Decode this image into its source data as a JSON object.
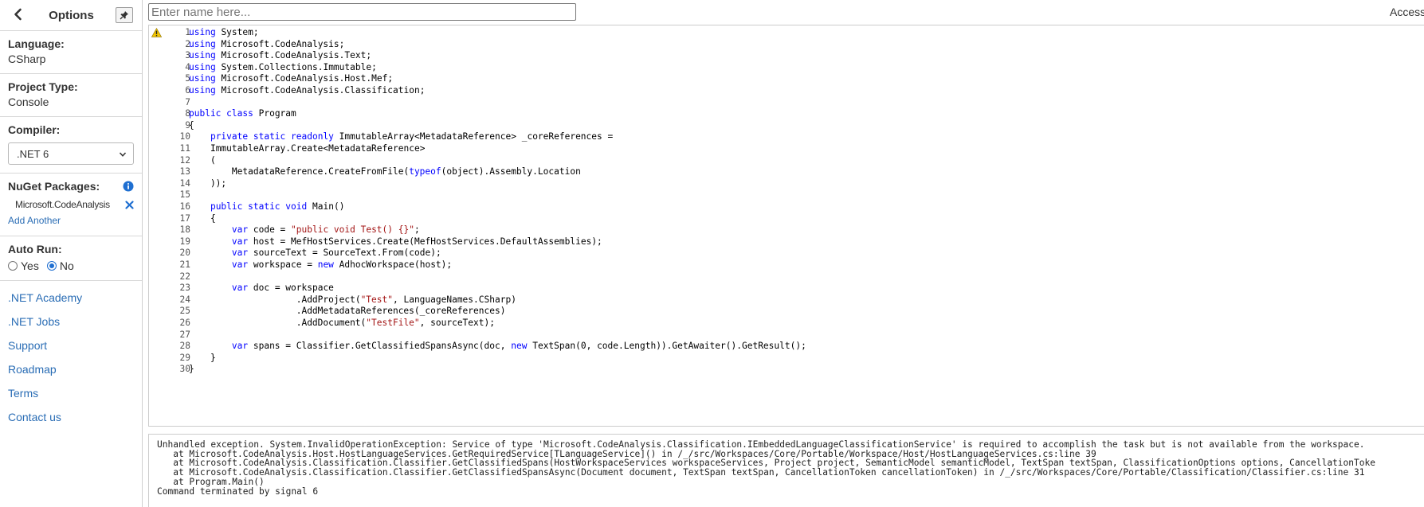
{
  "sidebar": {
    "title": "Options",
    "language": {
      "label": "Language:",
      "value": "CSharp"
    },
    "project_type": {
      "label": "Project Type:",
      "value": "Console"
    },
    "compiler": {
      "label": "Compiler:",
      "value": ".NET 6"
    },
    "nuget": {
      "label": "NuGet Packages:",
      "packages": [
        "Microsoft.CodeAnalysis"
      ],
      "add_label": "Add Another"
    },
    "auto_run": {
      "label": "Auto Run:",
      "options": [
        "Yes",
        "No"
      ],
      "selected": "No"
    },
    "links": [
      ".NET Academy",
      ".NET Jobs",
      "Support",
      "Roadmap",
      "Terms",
      "Contact us"
    ]
  },
  "topbar": {
    "name_placeholder": "Enter name here...",
    "name_value": "",
    "right_text": "Access"
  },
  "editor": {
    "warning_line": 1,
    "lines": [
      "using System;",
      "using Microsoft.CodeAnalysis;",
      "using Microsoft.CodeAnalysis.Text;",
      "using System.Collections.Immutable;",
      "using Microsoft.CodeAnalysis.Host.Mef;",
      "using Microsoft.CodeAnalysis.Classification;",
      "",
      "public class Program",
      "{",
      "    private static readonly ImmutableArray<MetadataReference> _coreReferences =",
      "    ImmutableArray.Create<MetadataReference>",
      "    (",
      "        MetadataReference.CreateFromFile(typeof(object).Assembly.Location",
      "    ));",
      "",
      "    public static void Main()",
      "    {",
      "        var code = \"public void Test() {}\";",
      "        var host = MefHostServices.Create(MefHostServices.DefaultAssemblies);",
      "        var sourceText = SourceText.From(code);",
      "        var workspace = new AdhocWorkspace(host);",
      "",
      "        var doc = workspace",
      "                    .AddProject(\"Test\", LanguageNames.CSharp)",
      "                    .AddMetadataReferences(_coreReferences)",
      "                    .AddDocument(\"TestFile\", sourceText);",
      "",
      "        var spans = Classifier.GetClassifiedSpansAsync(doc, new TextSpan(0, code.Length)).GetAwaiter().GetResult();",
      "    }",
      "}"
    ]
  },
  "output": {
    "lines": [
      "Unhandled exception. System.InvalidOperationException: Service of type 'Microsoft.CodeAnalysis.Classification.IEmbeddedLanguageClassificationService' is required to accomplish the task but is not available from the workspace.",
      "   at Microsoft.CodeAnalysis.Host.HostLanguageServices.GetRequiredService[TLanguageService]() in /_/src/Workspaces/Core/Portable/Workspace/Host/HostLanguageServices.cs:line 39",
      "   at Microsoft.CodeAnalysis.Classification.Classifier.GetClassifiedSpans(HostWorkspaceServices workspaceServices, Project project, SemanticModel semanticModel, TextSpan textSpan, ClassificationOptions options, CancellationToke",
      "   at Microsoft.CodeAnalysis.Classification.Classifier.GetClassifiedSpansAsync(Document document, TextSpan textSpan, CancellationToken cancellationToken) in /_/src/Workspaces/Core/Portable/Classification/Classifier.cs:line 31",
      "   at Program.Main()",
      "Command terminated by signal 6"
    ]
  },
  "colors": {
    "link": "#2a6db5",
    "keyword": "#0000ff",
    "string": "#a31515",
    "radio_selected": "#1f6fd1",
    "info_icon": "#1f6fd1"
  }
}
